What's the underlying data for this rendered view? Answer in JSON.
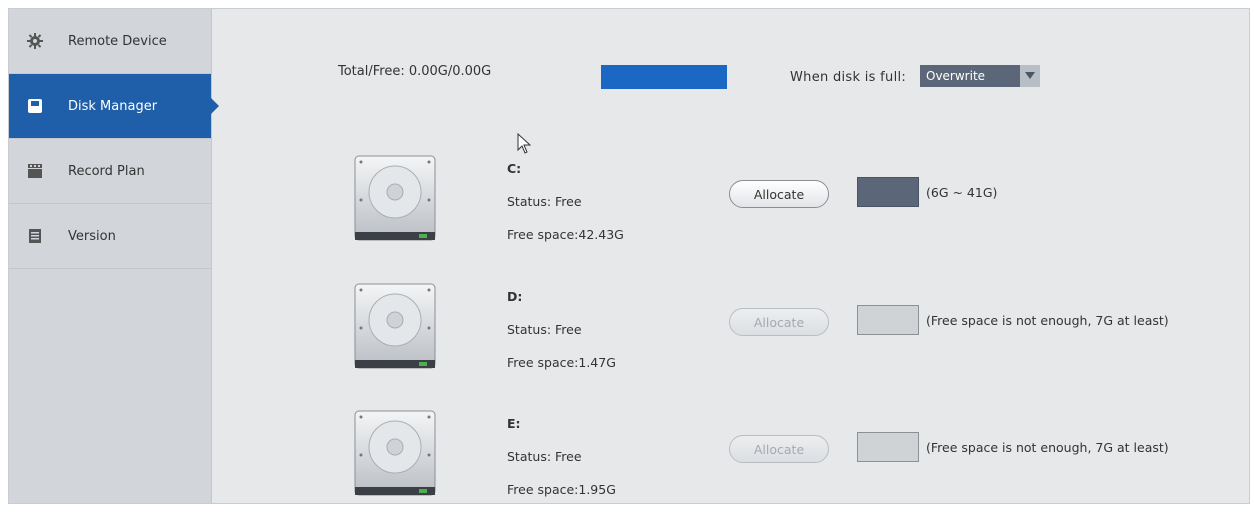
{
  "sidebar": {
    "items": [
      {
        "label": "Remote Device",
        "icon": "gear-icon"
      },
      {
        "label": "Disk Manager",
        "icon": "disk-icon",
        "active": true
      },
      {
        "label": "Record Plan",
        "icon": "clapperboard-icon"
      },
      {
        "label": "Version",
        "icon": "document-icon"
      }
    ]
  },
  "header": {
    "total_free": "Total/Free: 0.00G/0.00G",
    "disk_full_label": "When disk is full:",
    "disk_full_option": "Overwrite"
  },
  "disks": [
    {
      "letter": "C:",
      "status": "Status: Free",
      "free": "Free space:42.43G",
      "button": "Allocate",
      "hint": "(6G ~ 41G)",
      "enabled": true
    },
    {
      "letter": "D:",
      "status": "Status: Free",
      "free": "Free space:1.47G",
      "button": "Allocate",
      "hint": "(Free space is not enough, 7G at least)",
      "enabled": false
    },
    {
      "letter": "E:",
      "status": "Status: Free",
      "free": "Free space:1.95G",
      "button": "Allocate",
      "hint": "(Free space is not enough, 7G at least)",
      "enabled": false
    }
  ],
  "colors": {
    "accent": "#1f5ea8",
    "usage_bar": "#1a67c4",
    "select_bg": "#5b6778"
  }
}
